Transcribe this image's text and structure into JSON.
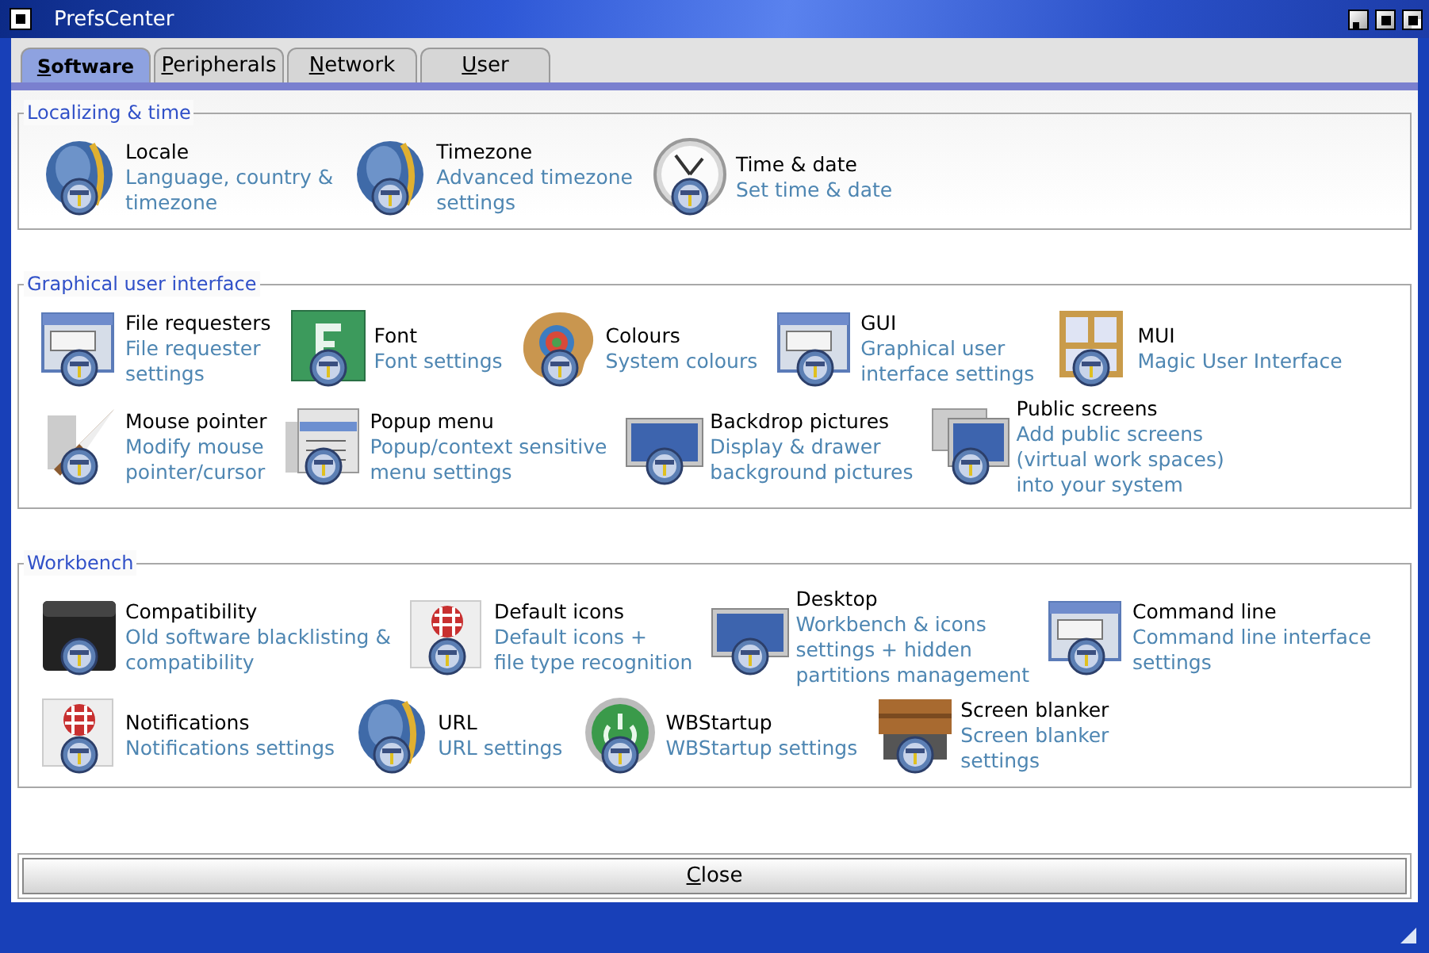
{
  "window": {
    "title": "PrefsCenter"
  },
  "tabs": [
    {
      "label": "Software",
      "selected": true
    },
    {
      "label": "Peripherals",
      "selected": false
    },
    {
      "label": "Network",
      "selected": false
    },
    {
      "label": "User",
      "selected": false
    }
  ],
  "groups": [
    {
      "title": "Localizing & time",
      "rows": [
        [
          {
            "title": "Locale",
            "description": [
              "Language, country &",
              "timezone"
            ]
          },
          {
            "title": "Timezone",
            "description": [
              "Advanced timezone",
              "settings"
            ]
          },
          {
            "title": "Time & date",
            "description": [
              "Set time & date"
            ]
          }
        ]
      ]
    },
    {
      "title": "Graphical user interface",
      "rows": [
        [
          {
            "title": "File requesters",
            "description": [
              "File requester",
              "settings"
            ]
          },
          {
            "title": "Font",
            "description": [
              "Font settings"
            ]
          },
          {
            "title": "Colours",
            "description": [
              "System colours"
            ]
          },
          {
            "title": "GUI",
            "description": [
              "Graphical user",
              "interface settings"
            ]
          },
          {
            "title": "MUI",
            "description": [
              "Magic User Interface"
            ]
          }
        ],
        [
          {
            "title": "Mouse pointer",
            "description": [
              "Modify mouse",
              "pointer/cursor"
            ]
          },
          {
            "title": "Popup menu",
            "description": [
              "Popup/context sensitive",
              "menu settings"
            ]
          },
          {
            "title": "Backdrop pictures",
            "description": [
              "Display & drawer",
              "background pictures"
            ]
          },
          {
            "title": "Public screens",
            "description": [
              "Add public screens",
              "(virtual work spaces)",
              "into your system"
            ]
          }
        ]
      ]
    },
    {
      "title": "Workbench",
      "rows": [
        [
          {
            "title": "Compatibility",
            "description": [
              "Old software blacklisting &",
              "compatibility"
            ]
          },
          {
            "title": "Default icons",
            "description": [
              "Default icons +",
              "file type recognition"
            ]
          },
          {
            "title": "Desktop",
            "description": [
              "Workbench & icons",
              "settings + hidden",
              "partitions management"
            ]
          },
          {
            "title": "Command line",
            "description": [
              "Command line interface",
              "settings"
            ]
          }
        ],
        [
          {
            "title": "Notifications",
            "description": [
              "Notifications settings"
            ]
          },
          {
            "title": "URL",
            "description": [
              "URL settings"
            ]
          },
          {
            "title": "WBStartup",
            "description": [
              "WBStartup settings"
            ]
          },
          {
            "title": "Screen blanker",
            "description": [
              "Screen blanker",
              "settings"
            ]
          }
        ]
      ]
    }
  ],
  "close_button": "Close"
}
